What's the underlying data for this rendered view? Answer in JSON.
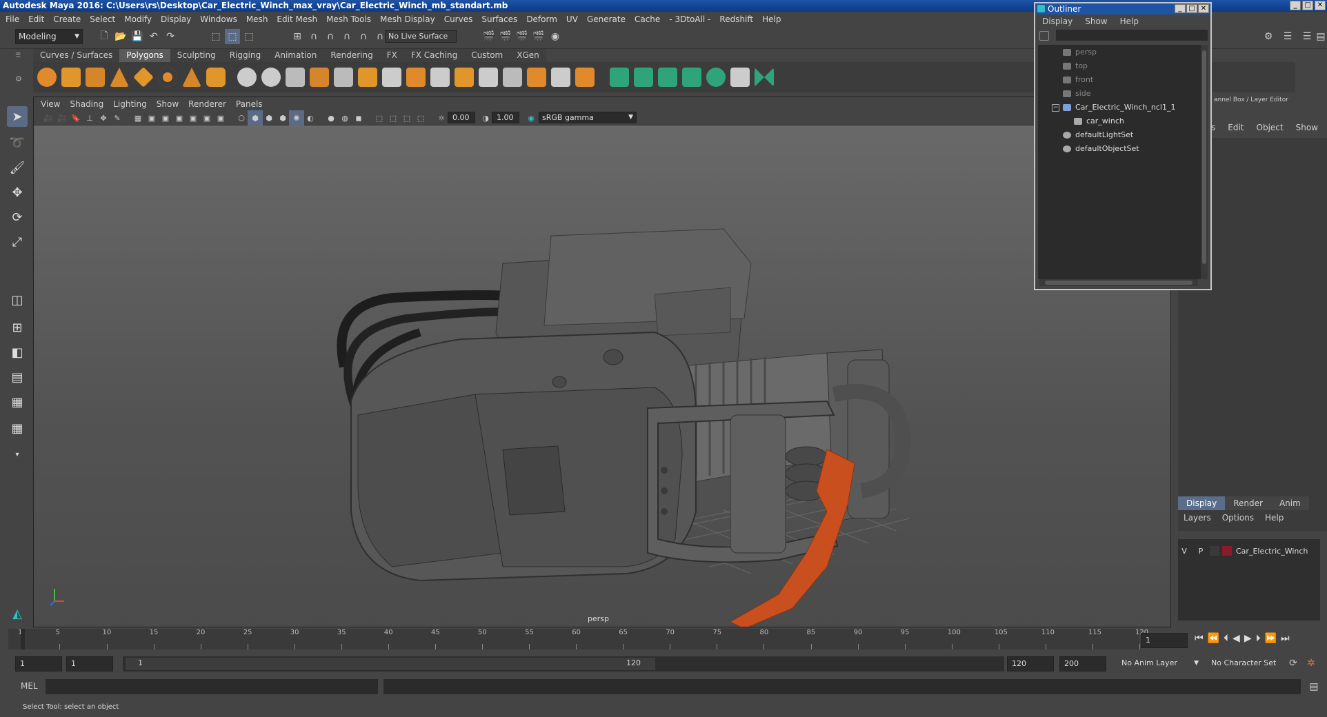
{
  "window": {
    "title": "Autodesk Maya 2016: C:\\Users\\rs\\Desktop\\Car_Electric_Winch_max_vray\\Car_Electric_Winch_mb_standart.mb"
  },
  "menus": [
    "File",
    "Edit",
    "Create",
    "Select",
    "Modify",
    "Display",
    "Windows",
    "Mesh",
    "Edit Mesh",
    "Mesh Tools",
    "Mesh Display",
    "Curves",
    "Surfaces",
    "Deform",
    "UV",
    "Generate",
    "Cache",
    "- 3DtoAll -",
    "Redshift",
    "Help"
  ],
  "status": {
    "mode": "Modeling",
    "live_surface": "No Live Surface"
  },
  "shelf_tabs": [
    "Curves / Surfaces",
    "Polygons",
    "Sculpting",
    "Rigging",
    "Animation",
    "Rendering",
    "FX",
    "FX Caching",
    "Custom",
    "XGen"
  ],
  "shelf_active": "Polygons",
  "viewport": {
    "menus": [
      "View",
      "Shading",
      "Lighting",
      "Show",
      "Renderer",
      "Panels"
    ],
    "exposure": "0.00",
    "gamma": "1.00",
    "color_space": "sRGB gamma",
    "camera": "persp"
  },
  "outliner": {
    "title": "Outliner",
    "menus": [
      "Display",
      "Show",
      "Help"
    ],
    "items": [
      {
        "label": "persp",
        "dim": true
      },
      {
        "label": "top",
        "dim": true
      },
      {
        "label": "front",
        "dim": true
      },
      {
        "label": "side",
        "dim": true
      },
      {
        "label": "Car_Electric_Winch_ncl1_1",
        "dim": false
      },
      {
        "label": "car_winch",
        "dim": false
      },
      {
        "label": "defaultLightSet",
        "dim": false
      },
      {
        "label": "defaultObjectSet",
        "dim": false
      }
    ]
  },
  "channel_box": {
    "title": "annel Box / Layer Editor",
    "menus": [
      "s",
      "Edit",
      "Object",
      "Show"
    ]
  },
  "layer_editor": {
    "tabs": [
      "Display",
      "Render",
      "Anim"
    ],
    "menus": [
      "Layers",
      "Options",
      "Help"
    ],
    "layer": {
      "v": "V",
      "p": "P",
      "name": "Car_Electric_Winch",
      "color": "#8b1a2b"
    }
  },
  "timeline": {
    "ticks": [
      "1",
      "5",
      "10",
      "15",
      "20",
      "25",
      "30",
      "35",
      "40",
      "45",
      "50",
      "55",
      "60",
      "65",
      "70",
      "75",
      "80",
      "85",
      "90",
      "95",
      "100",
      "105",
      "110",
      "115",
      "120"
    ],
    "current_frame": "1"
  },
  "range": {
    "start": "1",
    "start2": "1",
    "slider_start": "1",
    "slider_end": "120",
    "end": "120",
    "end2": "200",
    "anim_layer": "No Anim Layer",
    "char_set": "No Character Set"
  },
  "command": {
    "label": "MEL"
  },
  "help": {
    "text": "Select Tool: select an object"
  }
}
